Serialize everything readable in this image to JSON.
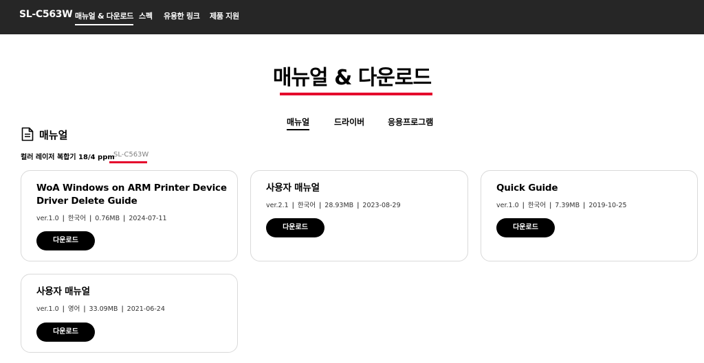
{
  "header": {
    "model": "SL-C563W",
    "nav": [
      "매뉴얼 & 다운로드",
      "스펙",
      "유용한 링크",
      "제품 지원"
    ]
  },
  "page": {
    "title": "매뉴얼 & 다운로드",
    "tabs": [
      "매뉴얼",
      "드라이버",
      "응용프로그램"
    ]
  },
  "section": {
    "title": "매뉴얼",
    "product_desc": "컬러 레이저 복합기 18/4 ppm",
    "product_model": "SL-C563W"
  },
  "cards": [
    {
      "title": "WoA Windows on ARM Printer Device Driver Delete Guide",
      "version": "ver.1.0",
      "language": "한국어",
      "size": "0.76MB",
      "date": "2024-07-11",
      "button": "다운로드"
    },
    {
      "title": "사용자 매뉴얼",
      "version": "ver.2.1",
      "language": "한국어",
      "size": "28.93MB",
      "date": "2023-08-29",
      "button": "다운로드"
    },
    {
      "title": "Quick Guide",
      "version": "ver.1.0",
      "language": "한국어",
      "size": "7.39MB",
      "date": "2019-10-25",
      "button": "다운로드"
    },
    {
      "title": "사용자 매뉴얼",
      "version": "ver.1.0",
      "language": "영어",
      "size": "33.09MB",
      "date": "2021-06-24",
      "button": "다운로드"
    }
  ],
  "colors": {
    "header_bg": "#262626",
    "accent_red": "#e4002b",
    "button_bg": "#000000"
  }
}
